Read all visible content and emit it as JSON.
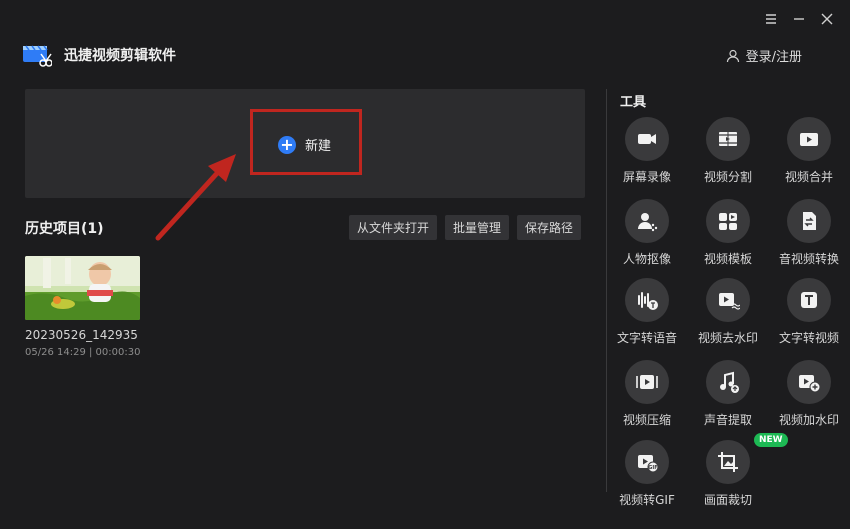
{
  "app": {
    "title": "迅捷视频剪辑软件"
  },
  "header": {
    "login_label": "登录/注册"
  },
  "new_project": {
    "label": "新建"
  },
  "history": {
    "title": "历史项目(1)",
    "buttons": [
      "从文件夹打开",
      "批量管理",
      "保存路径"
    ],
    "projects": [
      {
        "name": "20230526_142935",
        "meta": "05/26 14:29 | 00:00:30"
      }
    ]
  },
  "tools": {
    "title": "工具",
    "items": [
      {
        "label": "屏幕录像",
        "icon": "camera-icon"
      },
      {
        "label": "视频分割",
        "icon": "film-split-icon"
      },
      {
        "label": "视频合并",
        "icon": "video-merge-icon"
      },
      {
        "label": "人物抠像",
        "icon": "person-cutout-icon"
      },
      {
        "label": "视频模板",
        "icon": "template-icon"
      },
      {
        "label": "音视频转换",
        "icon": "convert-icon"
      },
      {
        "label": "文字转语音",
        "icon": "text-to-speech-icon"
      },
      {
        "label": "视频去水印",
        "icon": "remove-watermark-icon"
      },
      {
        "label": "文字转视频",
        "icon": "text-to-video-icon"
      },
      {
        "label": "视频压缩",
        "icon": "compress-icon"
      },
      {
        "label": "声音提取",
        "icon": "music-note-icon"
      },
      {
        "label": "视频加水印",
        "icon": "add-watermark-icon"
      },
      {
        "label": "视频转GIF",
        "icon": "gif-icon"
      },
      {
        "label": "画面裁切",
        "icon": "crop-icon",
        "badge": "NEW"
      }
    ]
  },
  "colors": {
    "accent": "#2f7cf6",
    "highlight": "#c0261f",
    "badge": "#1db954",
    "background": "#1c1c1e"
  }
}
